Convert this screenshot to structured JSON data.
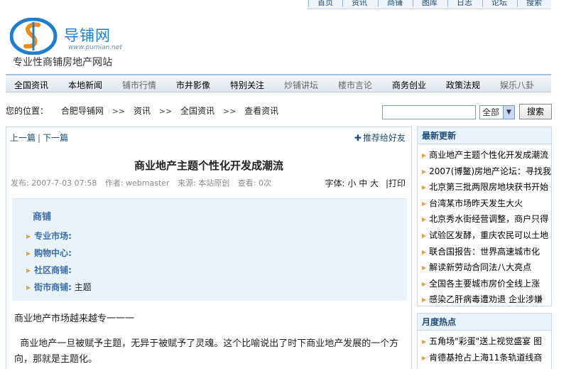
{
  "top_links": [
    "首页",
    "资讯",
    "商铺",
    "图库",
    "日志",
    "论坛",
    "搜索"
  ],
  "logo": {
    "name": "导铺网",
    "url_text": "www.pumian.net",
    "slogan": "专业性商铺房地产网站"
  },
  "nav": [
    {
      "label": "全国资讯",
      "dim": false
    },
    {
      "label": "本地新闻",
      "dim": false
    },
    {
      "label": "铺市行情",
      "dim": true
    },
    {
      "label": "市井影像",
      "dim": false
    },
    {
      "label": "特别关注",
      "dim": false
    },
    {
      "label": "炒铺讲坛",
      "dim": true
    },
    {
      "label": "楼市言论",
      "dim": true
    },
    {
      "label": "商务创业",
      "dim": false
    },
    {
      "label": "政策法规",
      "dim": false
    },
    {
      "label": "娱乐八卦",
      "dim": true
    }
  ],
  "location": {
    "label": "您的位置：",
    "crumbs": [
      "合肥导铺网",
      "资讯",
      "全国资讯",
      "查看资讯"
    ],
    "separator": ">>"
  },
  "search": {
    "select_value": "全部",
    "button": "搜索"
  },
  "article": {
    "prev": "上一篇",
    "next": "下一篇",
    "recommend": "推荐给好友",
    "title": "商业地产主题个性化开发成潮流",
    "meta": {
      "publish": "发布: 2007-7-03 07:58",
      "author": "作者: webmaster",
      "source": "来源: 本站原创",
      "views": "查看: 0次"
    },
    "font_label": "字体:",
    "font_sizes": [
      "小",
      "中",
      "大"
    ],
    "print": "打印",
    "category": {
      "heading": "商铺",
      "rows": [
        {
          "label": "专业市场:",
          "value": ""
        },
        {
          "label": "购物中心:",
          "value": ""
        },
        {
          "label": "社区商铺:",
          "value": ""
        },
        {
          "label": "街市商铺:",
          "value": "主题"
        }
      ]
    },
    "paragraphs": [
      "商业地产市场越来越专一一一",
      "  商业地产一旦被赋予主题，无异于被赋予了灵魂。这个比喻说出了时下商业地产发展的一个方向，那就是主题化。"
    ]
  },
  "sidebar": {
    "latest": {
      "heading": "最新更新",
      "items": [
        "商业地产主题个性化开发成潮流",
        "2007(博鳌)房地产论坛：寻找我",
        "北京第三批两限房地块获书开始",
        "台湾某市场昨天发生大火",
        "北京秀水街经营调整，商户只得",
        "试验区发酵，重庆农民可以土地",
        "联合国报告：世界高速城市化",
        "解读新劳动合同法八大亮点",
        "全国各主要城市房价全线上涨",
        "感染乙肝病毒遭劝退 企业涉嫌"
      ]
    },
    "monthly": {
      "heading": "月度热点",
      "items": [
        "五角场\"彩蛋\"送上视觉盛宴 图",
        "肯德基抢占上海11条轨道线商"
      ]
    }
  },
  "colors": {
    "accent": "#1c4b7a",
    "logo_blue": "#1e7fcf",
    "logo_orange": "#f08c1a",
    "bullet": "#e8a04a",
    "box_bg": "#eaf3fa"
  }
}
